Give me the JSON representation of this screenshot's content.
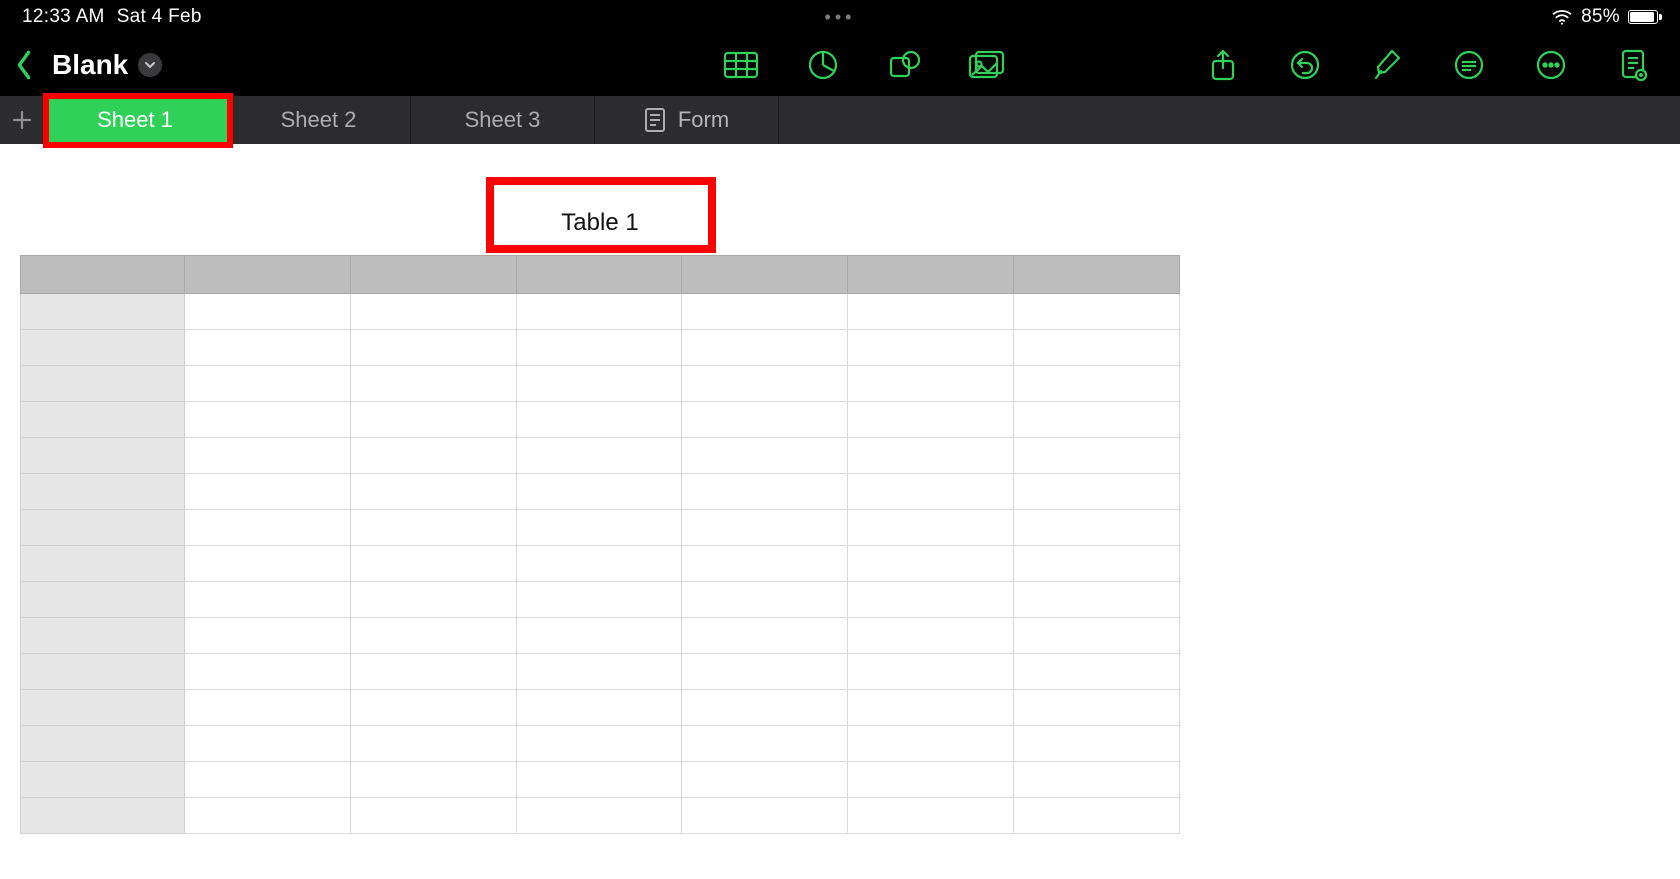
{
  "statusbar": {
    "time": "12:33 AM",
    "date": "Sat 4 Feb",
    "battery_pct": "85%"
  },
  "toolbar": {
    "doc_title": "Blank"
  },
  "tabs": {
    "items": [
      {
        "label": "Sheet 1",
        "active": true
      },
      {
        "label": "Sheet 2",
        "active": false
      },
      {
        "label": "Sheet 3",
        "active": false
      }
    ],
    "form_label": "Form"
  },
  "table": {
    "title": "Table 1",
    "columns": 7,
    "rows": 15
  },
  "colors": {
    "accent": "#30d158",
    "highlight": "#ff0000"
  }
}
